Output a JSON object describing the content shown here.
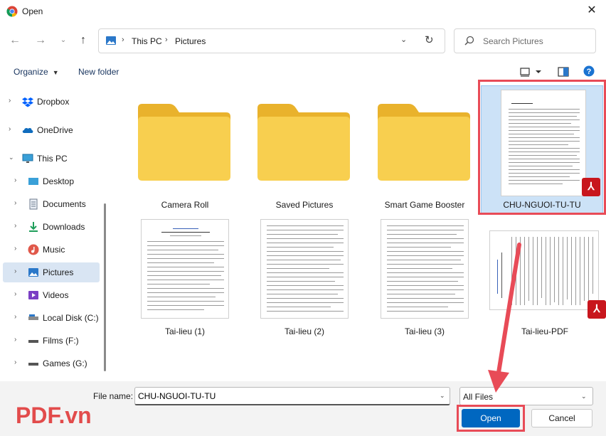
{
  "window": {
    "title": "Open"
  },
  "nav": {
    "breadcrumbs": [
      "This PC",
      "Pictures"
    ],
    "search_placeholder": "Search Pictures"
  },
  "toolbar": {
    "organize": "Organize",
    "new_folder": "New folder"
  },
  "sidebar": {
    "items": [
      {
        "label": "Dropbox",
        "icon": "dropbox-icon"
      },
      {
        "label": "OneDrive",
        "icon": "onedrive-icon"
      },
      {
        "label": "This PC",
        "icon": "computer-icon"
      },
      {
        "label": "Desktop",
        "icon": "desktop-icon"
      },
      {
        "label": "Documents",
        "icon": "documents-icon"
      },
      {
        "label": "Downloads",
        "icon": "downloads-icon"
      },
      {
        "label": "Music",
        "icon": "music-icon"
      },
      {
        "label": "Pictures",
        "icon": "pictures-icon"
      },
      {
        "label": "Videos",
        "icon": "videos-icon"
      },
      {
        "label": "Local Disk (C:)",
        "icon": "disk-icon"
      },
      {
        "label": "Films (F:)",
        "icon": "drive-icon"
      },
      {
        "label": "Games (G:)",
        "icon": "drive-icon"
      }
    ],
    "selected": "Pictures"
  },
  "files": [
    {
      "name": "Camera Roll",
      "type": "folder"
    },
    {
      "name": "Saved Pictures",
      "type": "folder"
    },
    {
      "name": "Smart Game Booster",
      "type": "folder"
    },
    {
      "name": "CHU-NGUOI-TU-TU",
      "type": "pdf",
      "selected": true
    },
    {
      "name": "Tai-lieu (1)",
      "type": "document"
    },
    {
      "name": "Tai-lieu (2)",
      "type": "document"
    },
    {
      "name": "Tai-lieu (3)",
      "type": "document"
    },
    {
      "name": "Tai-lieu-PDF",
      "type": "pdf"
    }
  ],
  "footer": {
    "file_name_label": "File name:",
    "file_name_value": "CHU-NGUOI-TU-TU",
    "file_type": "All Files",
    "open_label": "Open",
    "cancel_label": "Cancel"
  },
  "watermark": "PDF.vn",
  "colors": {
    "accent": "#0067c0",
    "highlight": "#e84b57",
    "selection": "#cce2f7",
    "pdf_badge": "#c8161d",
    "folder": "#f8c83f"
  }
}
